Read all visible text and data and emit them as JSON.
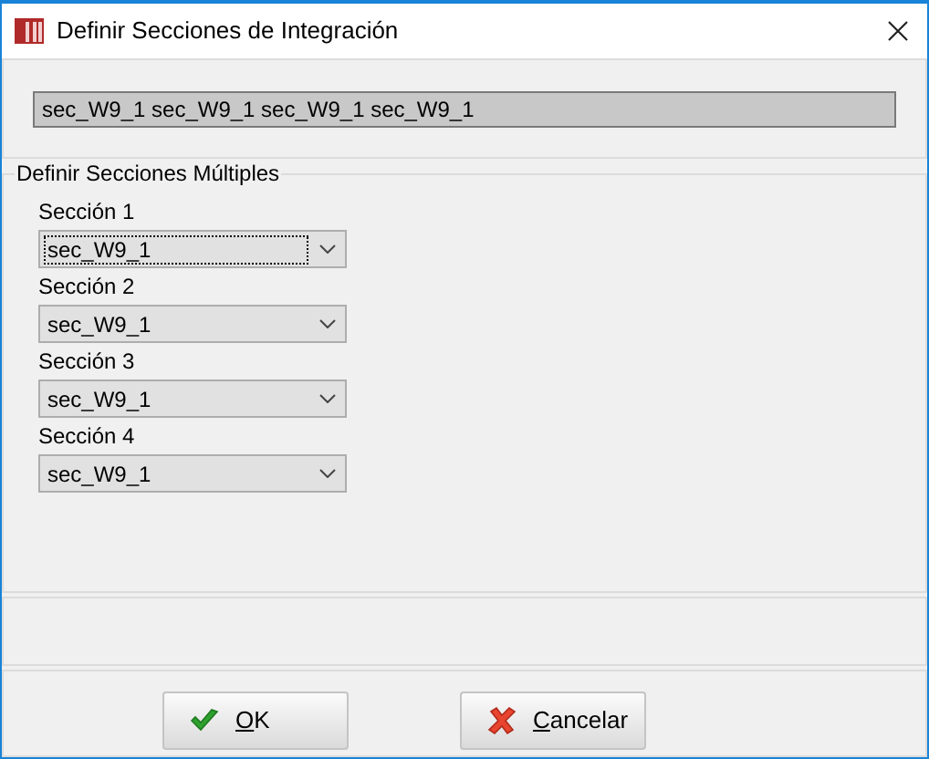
{
  "window": {
    "title": "Definir Secciones de Integración"
  },
  "summary_field": {
    "value": "sec_W9_1 sec_W9_1 sec_W9_1 sec_W9_1"
  },
  "group": {
    "title": "Definir Secciones Múltiples",
    "sections": [
      {
        "label": "Sección 1",
        "value": "sec_W9_1",
        "focused": true
      },
      {
        "label": "Sección 2",
        "value": "sec_W9_1",
        "focused": false
      },
      {
        "label": "Sección 3",
        "value": "sec_W9_1",
        "focused": false
      },
      {
        "label": "Sección 4",
        "value": "sec_W9_1",
        "focused": false
      }
    ]
  },
  "buttons": [
    {
      "kind": "ok",
      "label": "OK",
      "mnemonic_underlined": true
    },
    {
      "kind": "cancel",
      "label": "Cancelar",
      "mnemonic_underlined": true
    }
  ]
}
